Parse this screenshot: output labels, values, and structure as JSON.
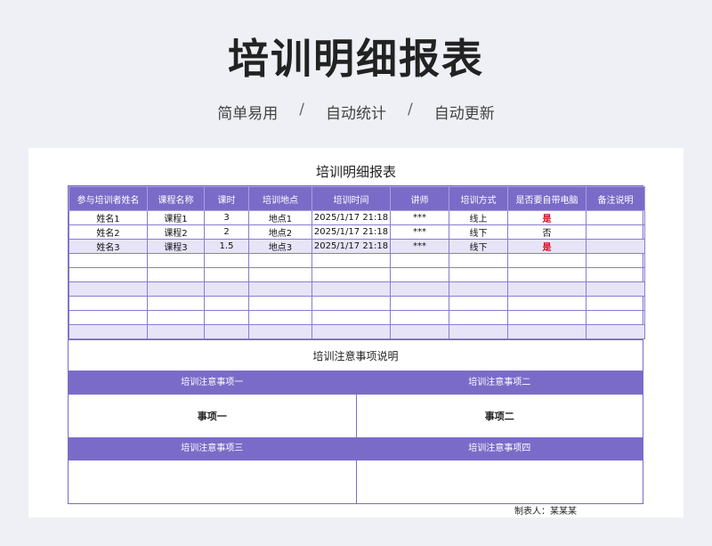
{
  "hero": {
    "title": "培训明细报表",
    "tagline": [
      "简单易用",
      "自动统计",
      "自动更新"
    ],
    "separator": "/"
  },
  "sheet": {
    "title": "培训明细报表",
    "columns": [
      "参与培训者姓名",
      "课程名称",
      "课时",
      "培训地点",
      "培训时间",
      "讲师",
      "培训方式",
      "是否要自带电脑",
      "备注说明"
    ],
    "rows": [
      [
        "姓名1",
        "课程1",
        "3",
        "地点1",
        "2025/1/17 21:18",
        "***",
        "线上",
        "是",
        ""
      ],
      [
        "姓名2",
        "课程2",
        "2",
        "地点2",
        "2025/1/17 21:18",
        "***",
        "线下",
        "否",
        ""
      ],
      [
        "姓名3",
        "课程3",
        "1.5",
        "地点3",
        "2025/1/17 21:18",
        "***",
        "线下",
        "是",
        ""
      ]
    ],
    "empty_row_count": 6,
    "highlight_value": "是",
    "highlight_color": "#e0001a"
  },
  "notes": {
    "title": "培训注意事项说明",
    "items": [
      {
        "head": "培训注意事项一",
        "body": "事项一"
      },
      {
        "head": "培训注意事项二",
        "body": "事项二"
      },
      {
        "head": "培训注意事项三",
        "body": ""
      },
      {
        "head": "培训注意事项四",
        "body": ""
      }
    ]
  },
  "footer": {
    "maker": "制表人：某某某"
  },
  "colors": {
    "accent": "#7b6bc8",
    "alt_row": "#e7e4f7",
    "page_bg": "#eef0f5"
  }
}
